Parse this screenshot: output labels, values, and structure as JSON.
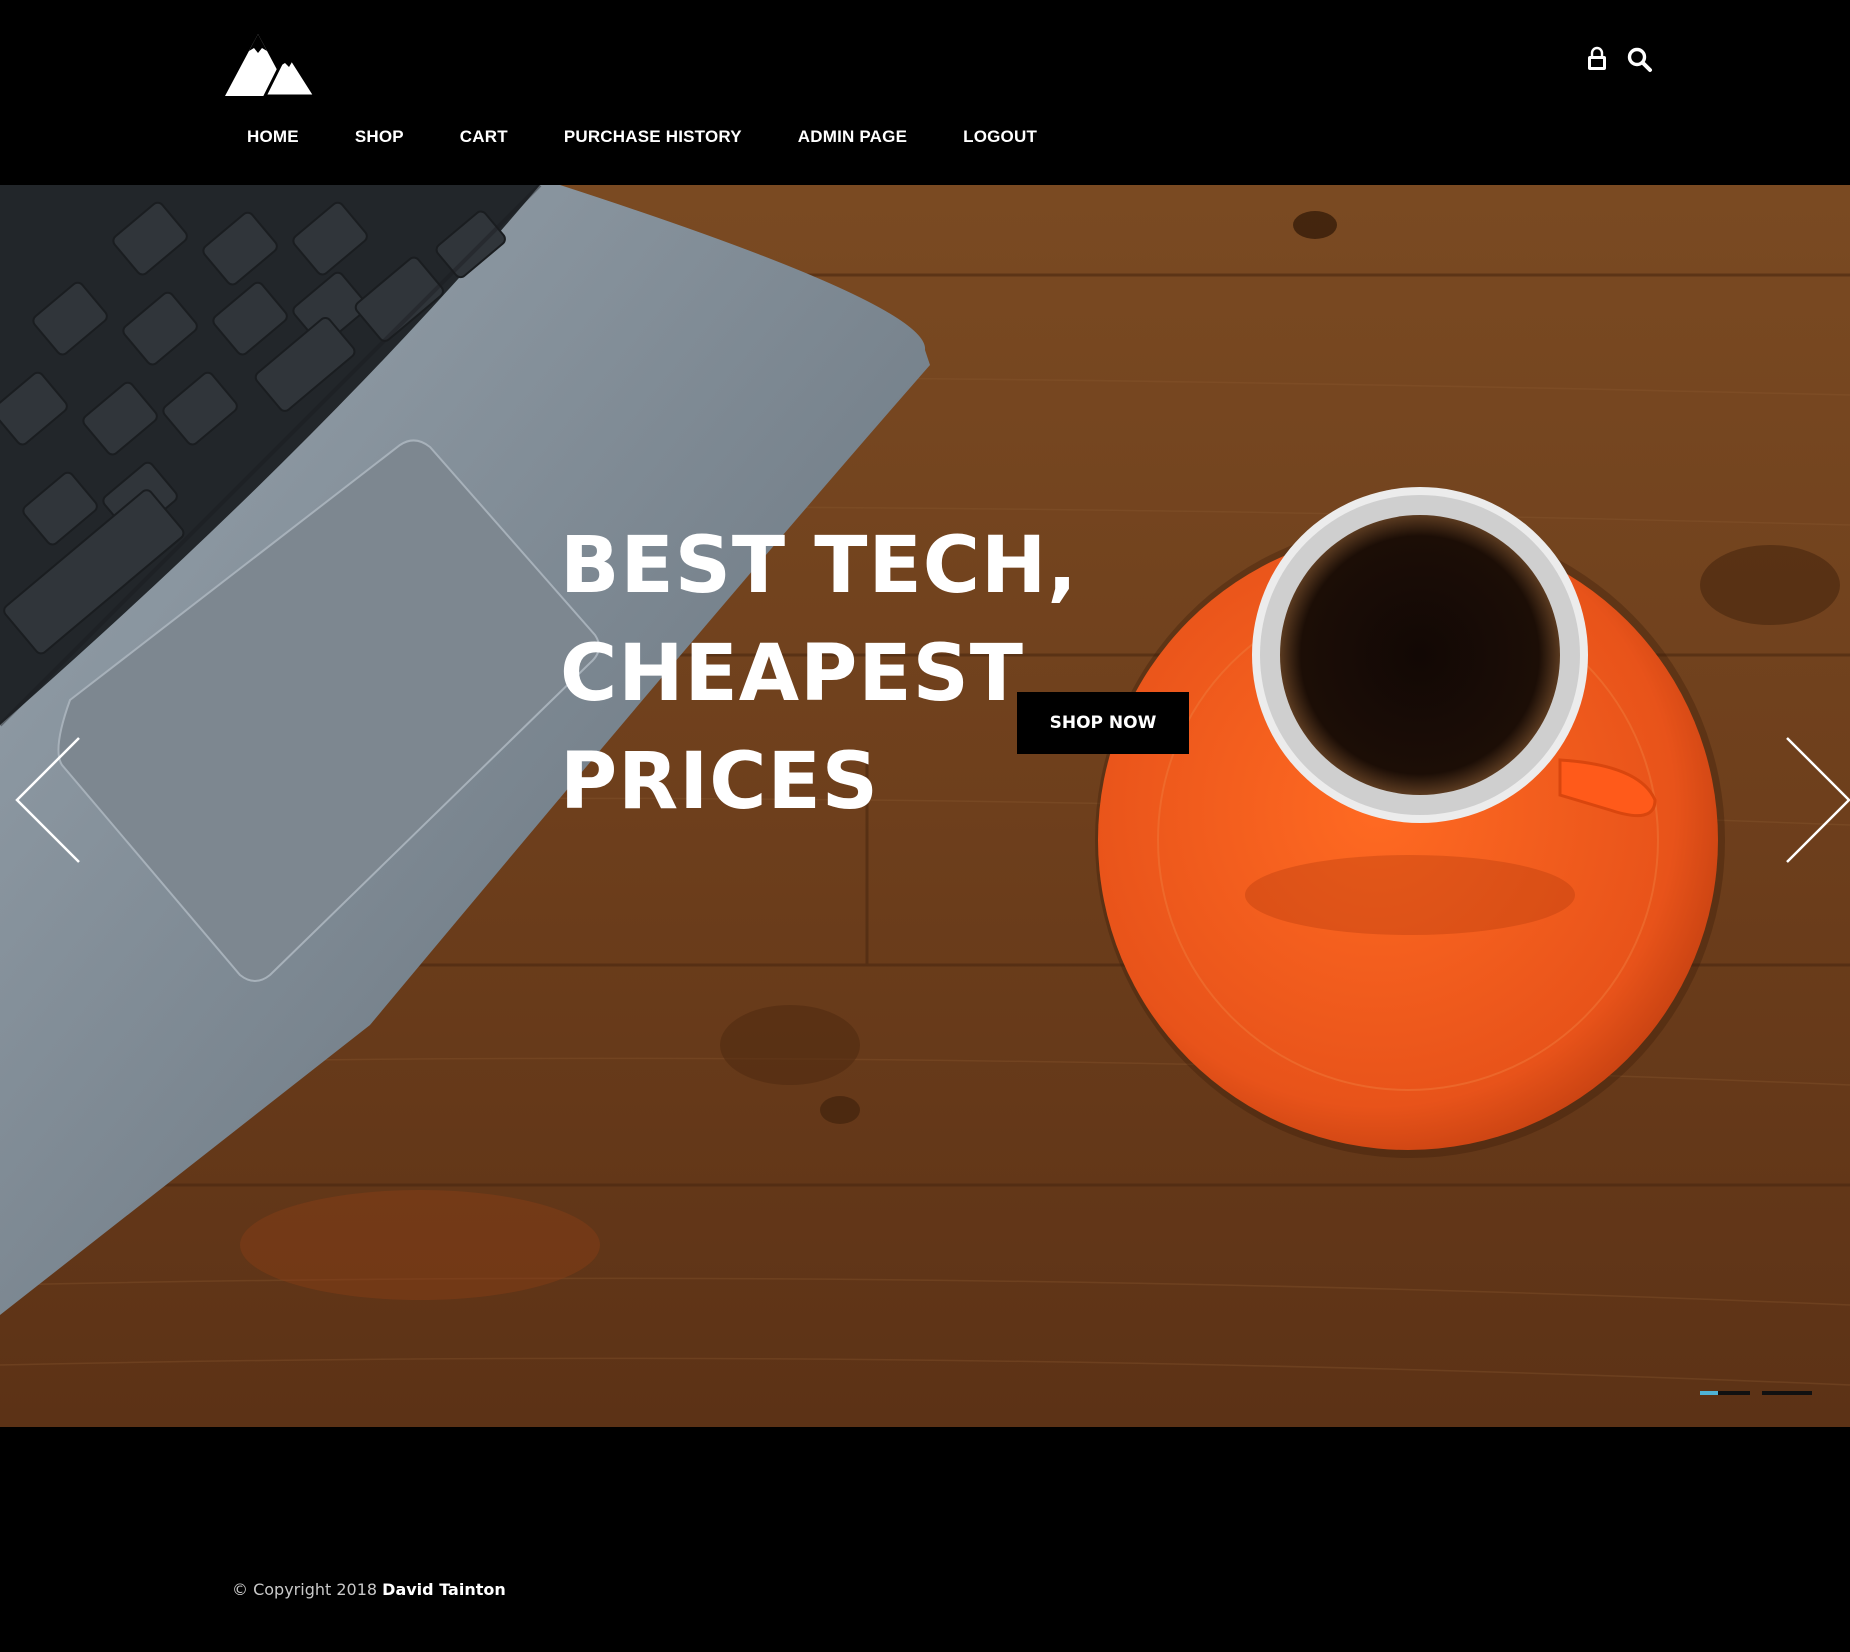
{
  "header": {
    "logo_icon": "mountain-logo-icon",
    "nav": [
      {
        "label": "HOME"
      },
      {
        "label": "SHOP"
      },
      {
        "label": "CART"
      },
      {
        "label": "PURCHASE HISTORY"
      },
      {
        "label": "ADMIN PAGE"
      },
      {
        "label": "LOGOUT"
      }
    ],
    "icons": {
      "cart": "shopping-bag-icon",
      "search": "search-icon"
    }
  },
  "hero": {
    "title_line1": "BEST TECH,",
    "title_line2": "CHEAPEST PRICES",
    "button_label": "SHOP NOW",
    "prev_icon": "chevron-left-icon",
    "next_icon": "chevron-right-icon",
    "slides_count": 2,
    "active_slide": 1,
    "accent_color": "#4fb3d6"
  },
  "footer": {
    "copyright_prefix": "© Copyright 2018",
    "author": "David Tainton"
  }
}
